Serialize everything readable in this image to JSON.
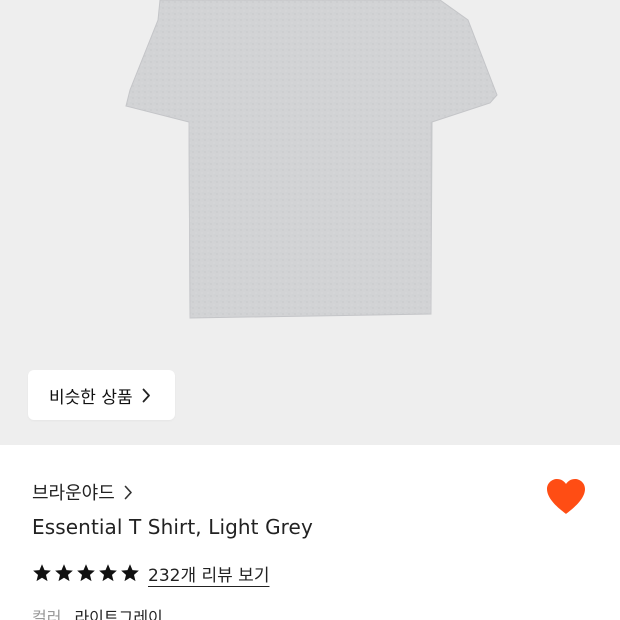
{
  "product_image": {
    "background": "#eeeeee",
    "garment_color": "#d2d3d5"
  },
  "similar_button": {
    "label": "비슷한 상품",
    "icon": "chevron-right-icon"
  },
  "product": {
    "brand": "브라운야드",
    "brand_icon": "chevron-right-icon",
    "title": "Essential T Shirt, Light Grey",
    "rating": 5,
    "review_link": "232개 리뷰 보기",
    "color_label": "컬러",
    "color_value": "라이트그레이",
    "wishlist_icon": "heart-icon",
    "wishlist_color": "#ff4d14"
  }
}
